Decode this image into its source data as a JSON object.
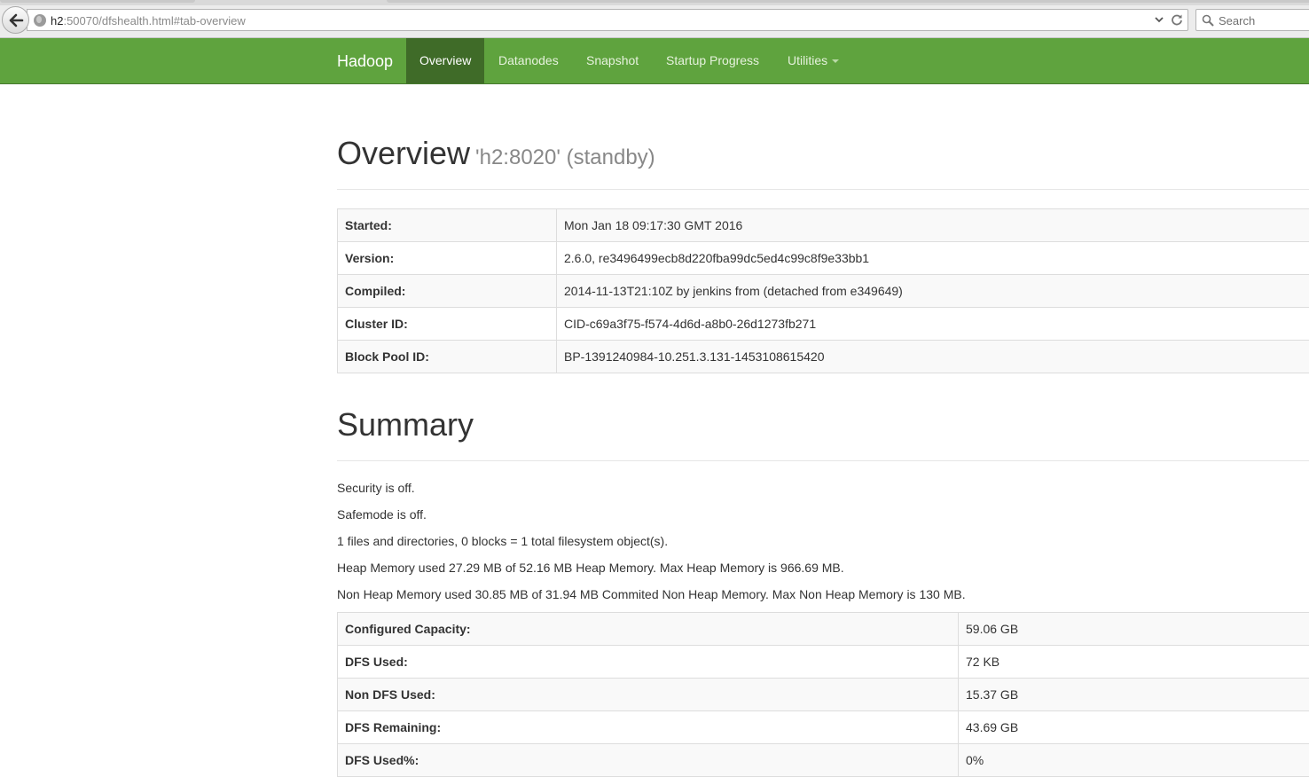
{
  "browser": {
    "url_host": "h2",
    "url_rest": ":50070/dfshealth.html#tab-overview",
    "search_placeholder": "Search"
  },
  "navbar": {
    "brand": "Hadoop",
    "items": [
      {
        "label": "Overview",
        "active": true
      },
      {
        "label": "Datanodes",
        "active": false
      },
      {
        "label": "Snapshot",
        "active": false
      },
      {
        "label": "Startup Progress",
        "active": false
      },
      {
        "label": "Utilities",
        "active": false
      }
    ]
  },
  "overview": {
    "title": "Overview",
    "subtitle": "'h2:8020' (standby)",
    "rows": [
      {
        "key": "Started:",
        "value": "Mon Jan 18 09:17:30 GMT 2016"
      },
      {
        "key": "Version:",
        "value": "2.6.0, re3496499ecb8d220fba99dc5ed4c99c8f9e33bb1"
      },
      {
        "key": "Compiled:",
        "value": "2014-11-13T21:10Z by jenkins from (detached from e349649)"
      },
      {
        "key": "Cluster ID:",
        "value": "CID-c69a3f75-f574-4d6d-a8b0-26d1273fb271"
      },
      {
        "key": "Block Pool ID:",
        "value": "BP-1391240984-10.251.3.131-1453108615420"
      }
    ]
  },
  "summary": {
    "title": "Summary",
    "lines": [
      "Security is off.",
      "Safemode is off.",
      "1 files and directories, 0 blocks = 1 total filesystem object(s).",
      "Heap Memory used 27.29 MB of 52.16 MB Heap Memory. Max Heap Memory is 966.69 MB.",
      "Non Heap Memory used 30.85 MB of 31.94 MB Commited Non Heap Memory. Max Non Heap Memory is 130 MB."
    ],
    "rows": [
      {
        "key": "Configured Capacity:",
        "value": "59.06 GB"
      },
      {
        "key": "DFS Used:",
        "value": "72 KB"
      },
      {
        "key": "Non DFS Used:",
        "value": "15.37 GB"
      },
      {
        "key": "DFS Remaining:",
        "value": "43.69 GB"
      },
      {
        "key": "DFS Used%:",
        "value": "0%"
      }
    ]
  }
}
